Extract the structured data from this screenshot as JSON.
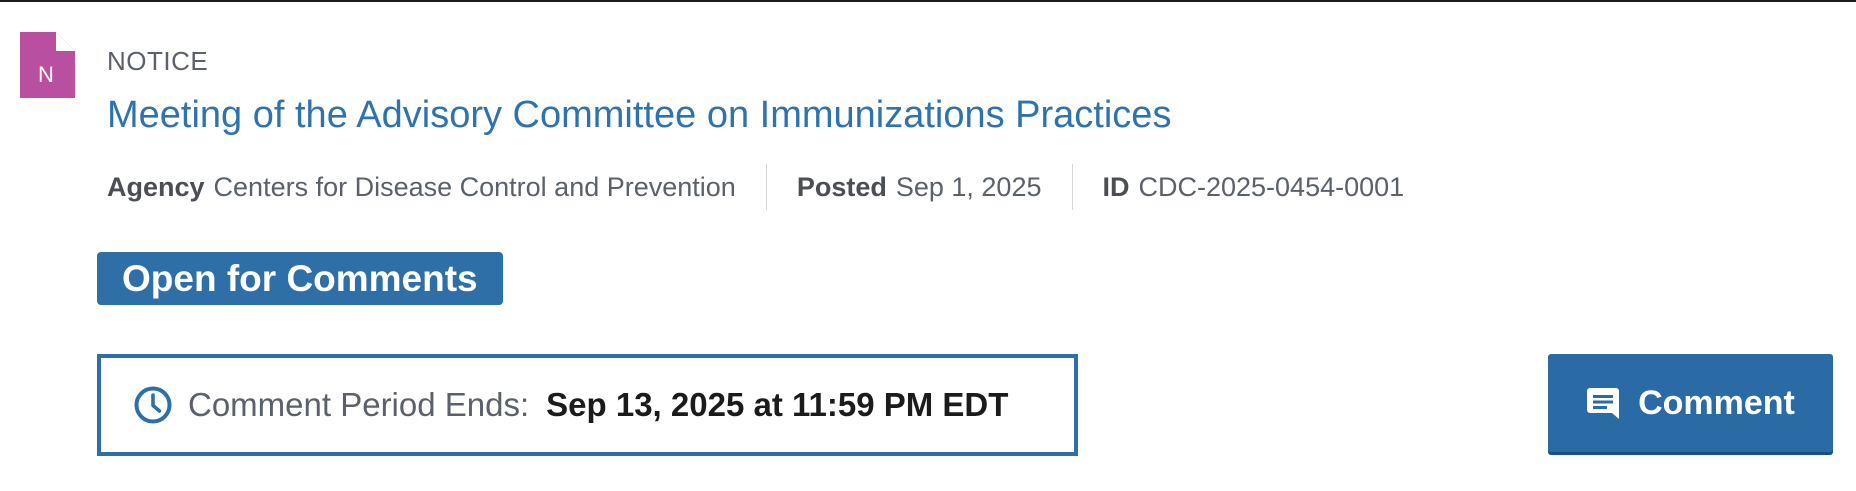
{
  "document": {
    "type_icon": "notice-document-icon",
    "type_icon_letter": "N",
    "type_label": "NOTICE",
    "title": "Meeting of the Advisory Committee on Immunizations Practices",
    "meta": {
      "agency_label": "Agency",
      "agency_value": "Centers for Disease Control and Prevention",
      "posted_label": "Posted",
      "posted_value": "Sep 1, 2025",
      "id_label": "ID",
      "id_value": "CDC-2025-0454-0001"
    },
    "status_badge": "Open for Comments",
    "comment_period": {
      "icon": "clock-icon",
      "label": "Comment Period Ends:",
      "value": "Sep 13, 2025 at 11:59 PM EDT"
    },
    "comment_button": {
      "icon": "comment-bubble-icon",
      "label": "Comment"
    }
  },
  "colors": {
    "link_blue": "#2f73ad",
    "accent_blue": "#2f6fa8",
    "notice_icon_purple": "#b84fa0",
    "muted_text": "#5b616b",
    "dark_text": "#1b1b1b"
  }
}
